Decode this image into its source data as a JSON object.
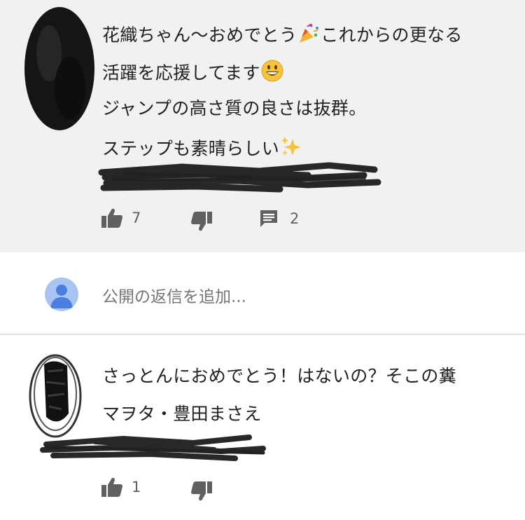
{
  "comment1": {
    "lines": [
      "花織ちゃん〜おめでとう",
      "これからの更なる",
      "活躍を応援してます",
      "ジャンプの高さ質の良さは抜群。",
      "ステップも素晴らしい"
    ],
    "emojis": [
      "party-popper",
      "grinning-face",
      "sparkles"
    ],
    "likes": "7",
    "replies": "2"
  },
  "reply_box": {
    "placeholder": "公開の返信を追加..."
  },
  "comment2": {
    "lines": [
      "さっとんにおめでとう！はないの？そこの糞",
      "マヲタ・豊田まさえ"
    ],
    "likes": "1"
  },
  "colors": {
    "comment_bg": "#f1f1f1",
    "icon_gray": "#606060",
    "avatar_blue": "#a9c4f0",
    "avatar_person": "#4a7fe0"
  }
}
